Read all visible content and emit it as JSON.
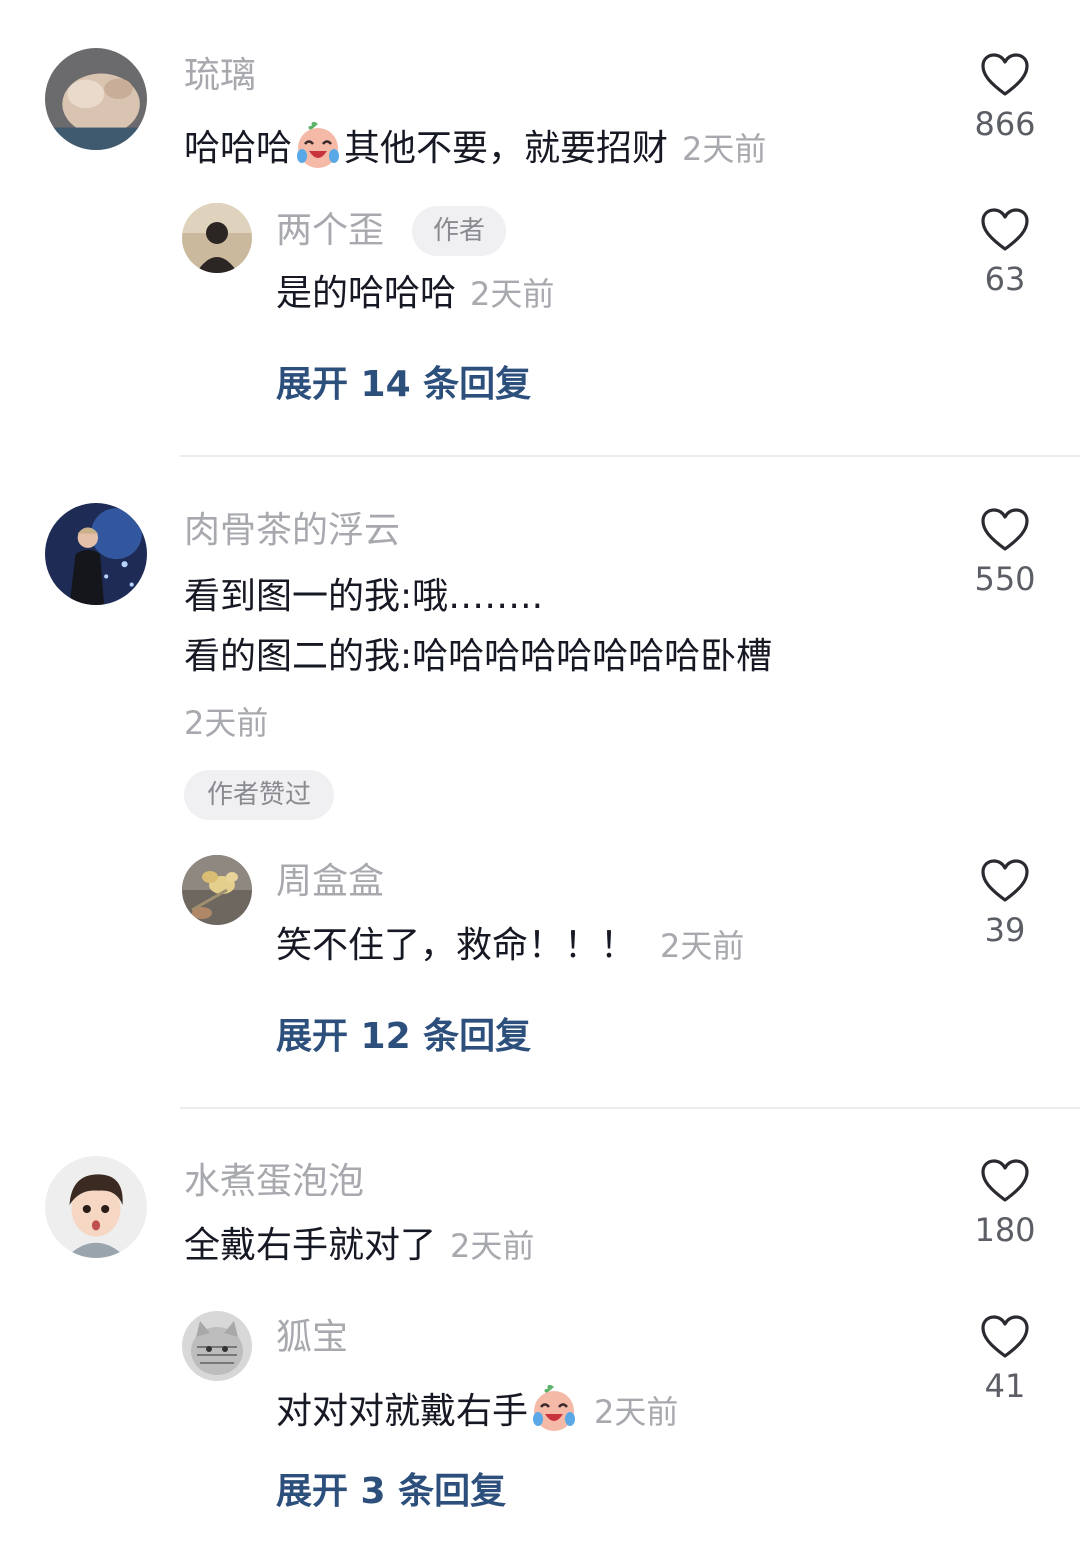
{
  "threads": [
    {
      "comment": {
        "username": "琉璃",
        "text": "哈哈哈",
        "text_after_emoji": "其他不要，就要招财",
        "emoji": "crying-laugh-emoji",
        "time": "2天前",
        "likes": "866"
      },
      "reply": {
        "username": "两个歪",
        "author_tag": "作者",
        "text": "是的哈哈哈",
        "time": "2天前",
        "likes": "63"
      },
      "expand_label": "展开 14 条回复"
    },
    {
      "comment": {
        "username": "肉骨茶的浮云",
        "text_line1": "看到图一的我:哦……..",
        "text_line2": "看的图二的我:哈哈哈哈哈哈哈哈卧槽",
        "time": "2天前",
        "liked_by_author": "作者赞过",
        "likes": "550"
      },
      "reply": {
        "username": "周盒盒",
        "text": "笑不住了，救命！！！",
        "time": "2天前",
        "likes": "39"
      },
      "expand_label": "展开 12 条回复"
    },
    {
      "comment": {
        "username": "水煮蛋泡泡",
        "text": "全戴右手就对了",
        "time": "2天前",
        "likes": "180"
      },
      "reply": {
        "username": "狐宝",
        "text": "对对对就戴右手",
        "emoji": "crying-laugh-emoji",
        "time": "2天前",
        "likes": "41"
      },
      "expand_label": "展开 3 条回复"
    }
  ],
  "colors": {
    "username": "#a7a9ae",
    "text": "#161823",
    "time": "#a7a9ae",
    "expand_link": "#2d4f7c",
    "like_count": "#5c5e66",
    "tag_background": "#f0f0f2"
  }
}
